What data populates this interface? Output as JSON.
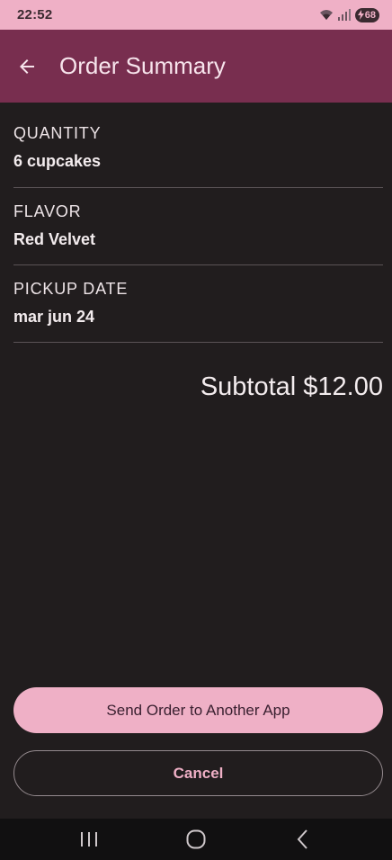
{
  "status_bar": {
    "time": "22:52",
    "battery_level": "68"
  },
  "app_bar": {
    "title": "Order Summary"
  },
  "summary": {
    "items": [
      {
        "label": "QUANTITY",
        "value": "6 cupcakes"
      },
      {
        "label": "FLAVOR",
        "value": "Red Velvet"
      },
      {
        "label": "PICKUP DATE",
        "value": "mar jun 24"
      }
    ],
    "subtotal": "Subtotal $12.00"
  },
  "actions": {
    "send_label": "Send Order to Another App",
    "cancel_label": "Cancel"
  },
  "colors": {
    "status_bar": "#efb0c6",
    "app_bar": "#782e4f",
    "background": "#211d1e",
    "accent": "#efb0c6"
  }
}
